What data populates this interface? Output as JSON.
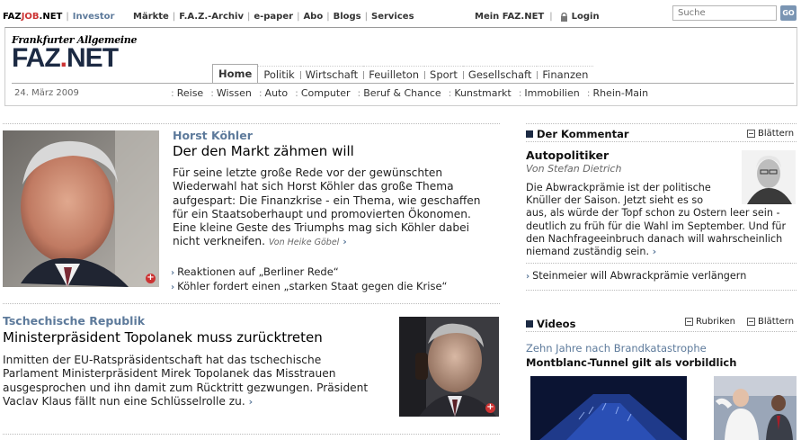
{
  "topbar": {
    "brand_faz": "FAZ",
    "brand_job": "JOB",
    "brand_net": ".NET",
    "investor": "Investor",
    "links": [
      "Märkte",
      "F.A.Z.-Archiv",
      "e-paper",
      "Abo",
      "Blogs",
      "Services"
    ],
    "mein_faz": "Mein FAZ.NET",
    "login": "Login",
    "search_placeholder": "Suche",
    "go_label": "GO"
  },
  "header": {
    "logo_top": "Frankfurter Allgemeine",
    "logo_main": "FAZ",
    "logo_dot": ".",
    "logo_net": "NET",
    "date": "24. März 2009",
    "nav_primary": [
      "Home",
      "Politik",
      "Wirtschaft",
      "Feuilleton",
      "Sport",
      "Gesellschaft",
      "Finanzen"
    ],
    "nav_primary_active": "Home",
    "nav_secondary": [
      "Reise",
      "Wissen",
      "Auto",
      "Computer",
      "Beruf & Chance",
      "Kunstmarkt",
      "Immobilien",
      "Rhein-Main"
    ]
  },
  "article1": {
    "kicker": "Horst Köhler",
    "headline": "Der den Markt zähmen will",
    "lines": [
      "Für seine letzte große Rede vor der gewünschten",
      "Wiederwahl hat sich Horst Köhler das große Thema",
      "aufgespart: Die Finanzkrise - ein Thema, wie geschaffen",
      "für ein Staatsoberhaupt und promovierten Ökonomen.",
      "Eine kleine Geste des Triumphs mag sich Köhler dabei",
      "nicht verkneifen."
    ],
    "author": "Von Heike Göbel",
    "related": [
      "Reaktionen auf „Berliner Rede“",
      "Köhler fordert einen „starken Staat gegen die Krise“"
    ]
  },
  "article2": {
    "kicker": "Tschechische Republik",
    "headline": "Ministerpräsident Topolanek muss zurücktreten",
    "lines": [
      "Inmitten der EU-Ratspräsidentschaft hat das tschechische",
      "Parlament Ministerpräsident Mirek Topolanek das Misstrauen",
      "ausgesprochen und ihn damit zum Rücktritt gezwungen. Präsident",
      "Vaclav Klaus fällt nun eine Schlüsselrolle zu."
    ]
  },
  "sidebar": {
    "kommentar_header": "Der Kommentar",
    "blaettern": "Blättern",
    "comment_title": "Autopolitiker",
    "comment_author": "Von Stefan Dietrich",
    "comment_lines": [
      "Die Abwrackprämie ist der politische",
      "Knüller der Saison. Jetzt sieht es so",
      "aus, als würde der Topf schon zu Ostern leer sein -",
      "deutlich zu früh für die Wahl im September. Und für",
      "den Nachfrageeinbruch danach will wahrscheinlich",
      "niemand zuständig sein."
    ],
    "comment_link": "Steinmeier will Abwrackprämie verlängern",
    "videos_header": "Videos",
    "rubriken": "Rubriken",
    "video_kicker": "Zehn Jahre nach Brandkatastrophe",
    "video_headline": "Montblanc-Tunnel gilt als vorbildlich"
  }
}
